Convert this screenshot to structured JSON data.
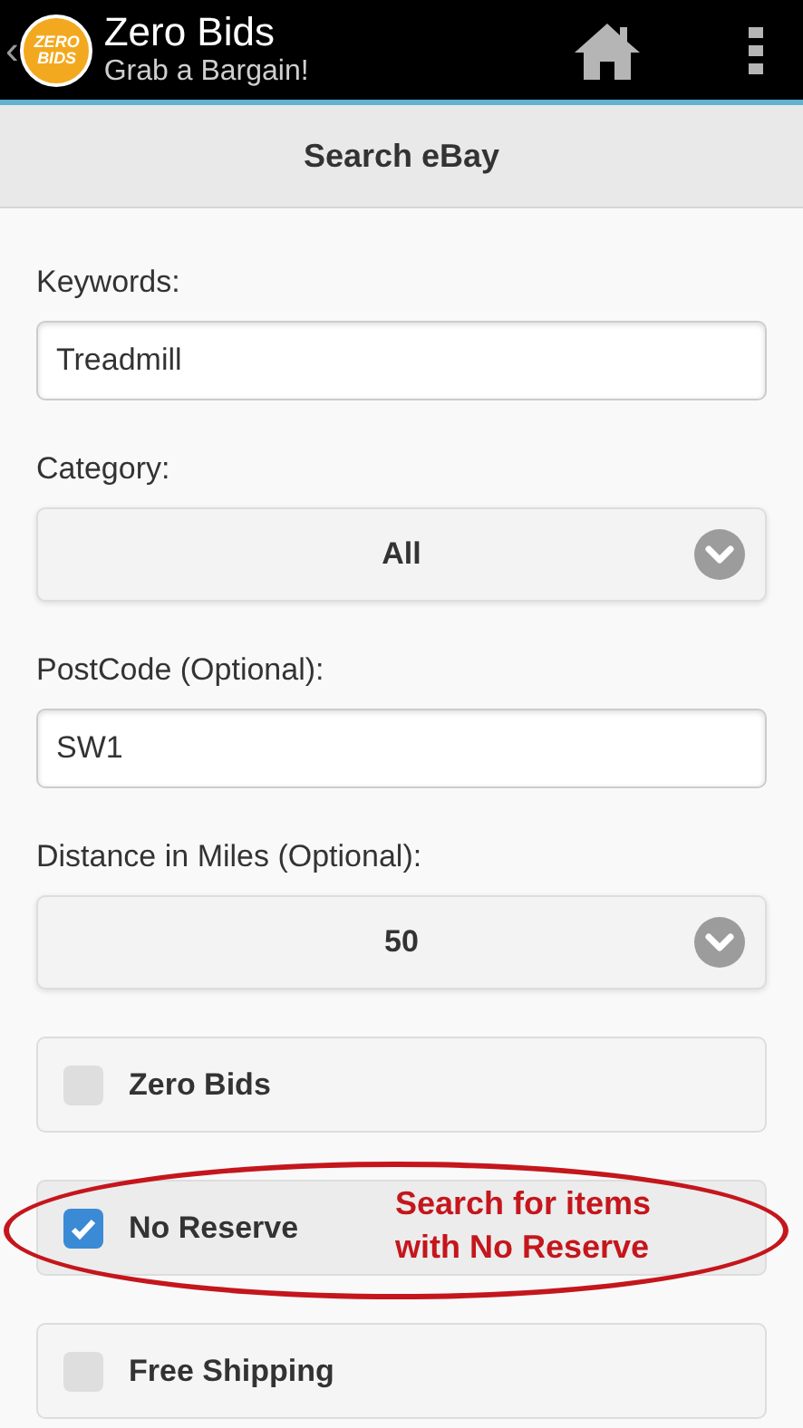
{
  "app_bar": {
    "back": "‹",
    "logo": "ZERO BIDS",
    "title": "Zero Bids",
    "subtitle": "Grab a Bargain!"
  },
  "page_title": "Search eBay",
  "fields": [
    {
      "kind": "text",
      "label": "Keywords:",
      "value": "Treadmill"
    },
    {
      "kind": "select",
      "label": "Category:",
      "value": "All"
    },
    {
      "kind": "text",
      "label": "PostCode (Optional):",
      "value": "SW1"
    },
    {
      "kind": "select",
      "label": "Distance in Miles (Optional):",
      "value": "50"
    }
  ],
  "options": [
    {
      "label": "Zero Bids",
      "checked": false
    },
    {
      "label": "No Reserve",
      "checked": true,
      "annotation": "Search for items with No Reserve"
    },
    {
      "label": "Free Shipping",
      "checked": false
    }
  ]
}
